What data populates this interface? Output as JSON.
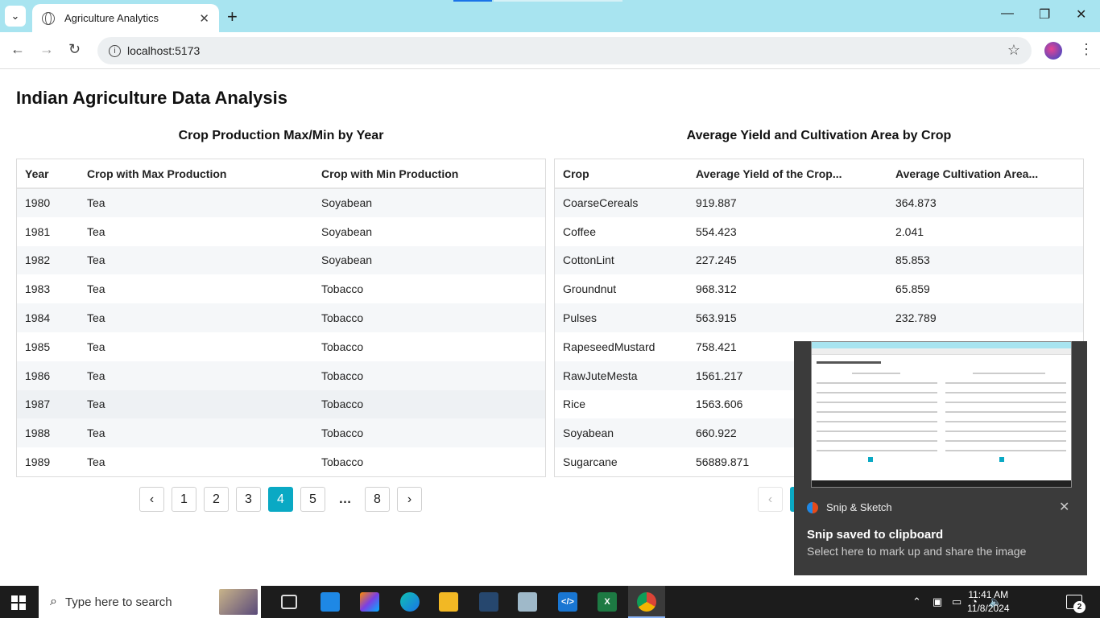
{
  "browser": {
    "tab_title": "Agriculture Analytics",
    "url": "localhost:5173"
  },
  "page": {
    "title": "Indian Agriculture Data Analysis"
  },
  "left_table": {
    "heading": "Crop Production Max/Min by Year",
    "columns": [
      "Year",
      "Crop with Max Production",
      "Crop with Min Production"
    ],
    "rows": [
      [
        "1980",
        "Tea",
        "Soyabean"
      ],
      [
        "1981",
        "Tea",
        "Soyabean"
      ],
      [
        "1982",
        "Tea",
        "Soyabean"
      ],
      [
        "1983",
        "Tea",
        "Tobacco"
      ],
      [
        "1984",
        "Tea",
        "Tobacco"
      ],
      [
        "1985",
        "Tea",
        "Tobacco"
      ],
      [
        "1986",
        "Tea",
        "Tobacco"
      ],
      [
        "1987",
        "Tea",
        "Tobacco"
      ],
      [
        "1988",
        "Tea",
        "Tobacco"
      ],
      [
        "1989",
        "Tea",
        "Tobacco"
      ]
    ],
    "pagination": {
      "prev": "‹",
      "pages": [
        "1",
        "2",
        "3",
        "4",
        "5",
        "…",
        "8"
      ],
      "active": "4",
      "next": "›"
    }
  },
  "right_table": {
    "heading": "Average Yield and Cultivation Area by Crop",
    "columns": [
      "Crop",
      "Average Yield of the Crop...",
      "Average Cultivation Area..."
    ],
    "rows": [
      [
        "CoarseCereals",
        "919.887",
        "364.873"
      ],
      [
        "Coffee",
        "554.423",
        "2.041"
      ],
      [
        "CottonLint",
        "227.245",
        "85.853"
      ],
      [
        "Groundnut",
        "968.312",
        "65.859"
      ],
      [
        "Pulses",
        "563.915",
        "232.789"
      ],
      [
        "RapeseedMustard",
        "758.421",
        ""
      ],
      [
        "RawJuteMesta",
        "1561.217",
        ""
      ],
      [
        "Rice",
        "1563.606",
        ""
      ],
      [
        "Soyabean",
        "660.922",
        ""
      ],
      [
        "Sugarcane",
        "56889.871",
        ""
      ]
    ],
    "pagination": {
      "prev": "‹"
    }
  },
  "toast": {
    "app_name": "Snip & Sketch",
    "title": "Snip saved to clipboard",
    "body": "Select here to mark up and share the image"
  },
  "taskbar": {
    "search_placeholder": "Type here to search",
    "time": "11:41 AM",
    "date": "11/8/2024",
    "notification_count": "2"
  }
}
